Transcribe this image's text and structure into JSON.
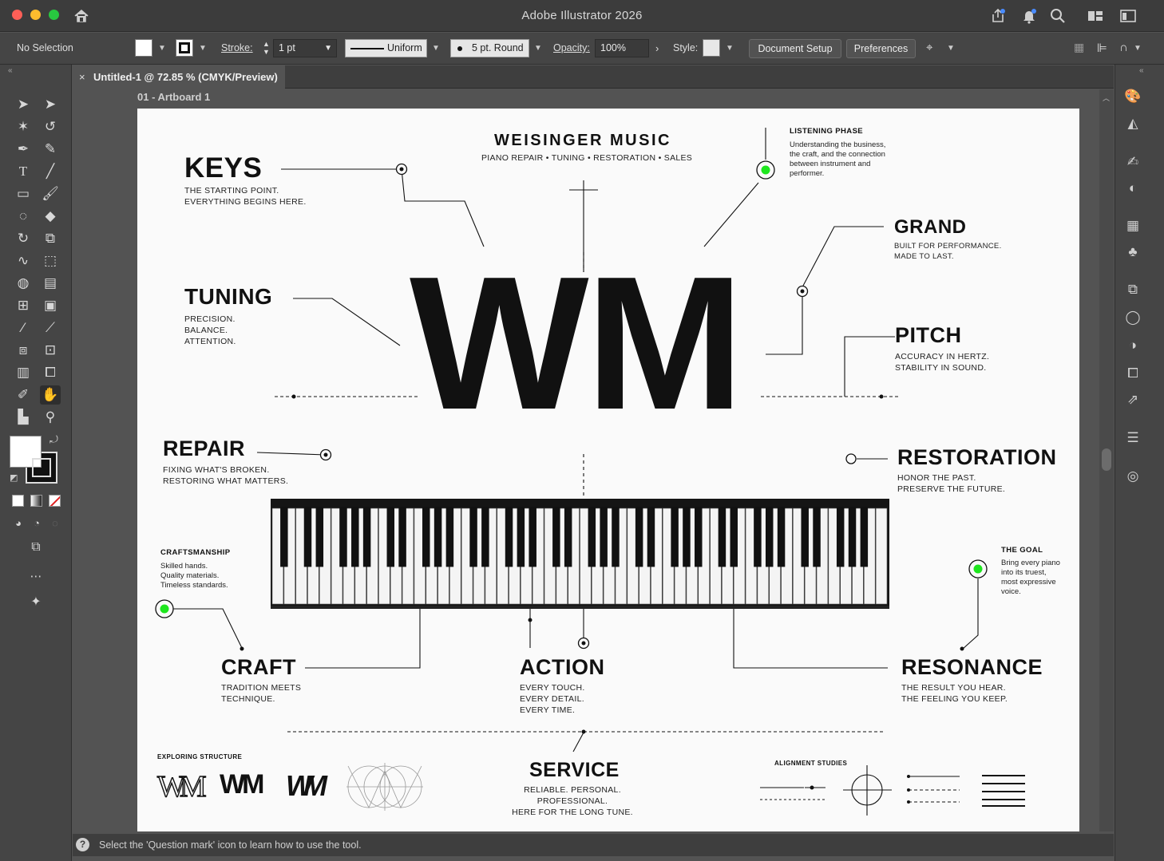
{
  "app": {
    "title": "Adobe Illustrator 2026",
    "window_controls": {
      "close_color": "#fe5f57",
      "minimize_color": "#febc2e",
      "zoom_color": "#28c840"
    }
  },
  "titlebar_icons": [
    "home-icon",
    "share-icon",
    "notifications-icon",
    "search-icon",
    "workspace-icon",
    "arrange-documents-icon"
  ],
  "control_bar": {
    "selection": "No Selection",
    "stroke_label": "Stroke:",
    "stroke_weight": "1 pt",
    "variable_width_profile": "Uniform",
    "brush": "5 pt. Round",
    "opacity_label": "Opacity:",
    "opacity_value": "100%",
    "style_label": "Style:",
    "document_setup": "Document Setup",
    "preferences": "Preferences"
  },
  "document": {
    "tab_title": "Untitled-1 @ 72.85 % (CMYK/Preview)",
    "close_glyph": "×",
    "artboard_label": "01 - Artboard 1"
  },
  "status_bar": {
    "help_glyph": "?",
    "message": "Select the 'Question mark' icon to learn how to use the tool."
  },
  "artwork": {
    "brand_title": "WEISINGER MUSIC",
    "brand_services": "PIANO REPAIR • TUNING • RESTORATION • SALES",
    "monogram": "WM",
    "accent_color": "#1ee61e",
    "sections": {
      "keys": {
        "title": "KEYS",
        "text": "THE STARTING POINT.\nEVERYTHING BEGINS HERE."
      },
      "tuning": {
        "title": "TUNING",
        "text": "PRECISION.\nBALANCE.\nATTENTION."
      },
      "repair": {
        "title": "REPAIR",
        "text": "FIXING WHAT'S BROKEN.\nRESTORING WHAT MATTERS."
      },
      "craftsmanship": {
        "title": "CRAFTSMANSHIP",
        "text": "Skilled hands.\nQuality materials.\nTimeless standards."
      },
      "craft": {
        "title": "CRAFT",
        "text": "TRADITION MEETS\nTECHNIQUE."
      },
      "action": {
        "title": "ACTION",
        "text": "EVERY TOUCH.\nEVERY DETAIL.\nEVERY TIME."
      },
      "listening": {
        "title": "LISTENING PHASE",
        "text": "Understanding the business,\nthe craft, and the connection\nbetween instrument and\nperformer."
      },
      "grand": {
        "title": "GRAND",
        "text": "BUILT FOR PERFORMANCE.\nMADE TO LAST."
      },
      "pitch": {
        "title": "PITCH",
        "text": "ACCURACY IN HERTZ.\nSTABILITY IN SOUND."
      },
      "restoration": {
        "title": "RESTORATION",
        "text": "HONOR THE PAST.\nPRESERVE THE FUTURE."
      },
      "goal": {
        "title": "THE GOAL",
        "text": "Bring every piano\ninto its truest,\nmost expressive\nvoice."
      },
      "resonance": {
        "title": "RESONANCE",
        "text": "THE RESULT YOU HEAR.\nTHE FEELING YOU KEEP."
      },
      "service": {
        "title": "SERVICE",
        "text": "RELIABLE. PERSONAL. PROFESSIONAL.\nHERE FOR THE LONG TUNE."
      }
    },
    "exploring_structure": {
      "label": "EXPLORING STRUCTURE",
      "marks": [
        "WM",
        "WM",
        "WM"
      ]
    },
    "alignment_studies": {
      "label": "ALIGNMENT STUDIES"
    },
    "keyboard": {
      "white_keys": 52
    }
  }
}
